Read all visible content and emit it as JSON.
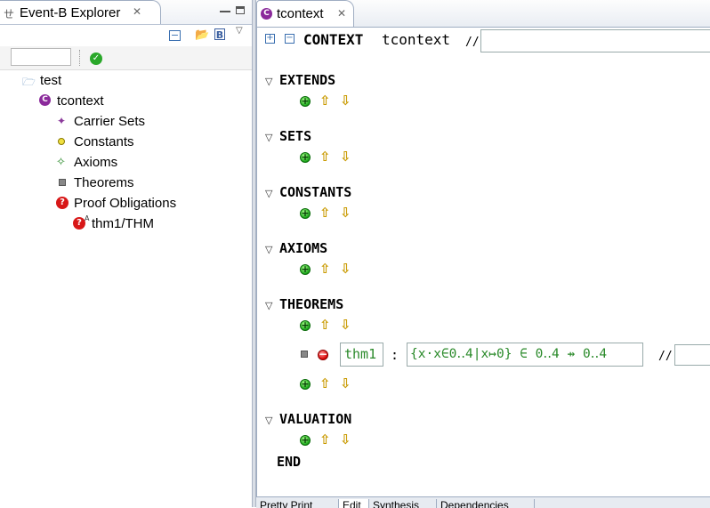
{
  "explorer": {
    "title": "Event-B Explorer",
    "filter_value": "",
    "tree": [
      {
        "label": "test",
        "icon": "folder-open-icon"
      },
      {
        "label": "tcontext",
        "icon": "context-icon"
      },
      {
        "label": "Carrier Sets",
        "icon": "carrier-sets-icon"
      },
      {
        "label": "Constants",
        "icon": "constants-icon"
      },
      {
        "label": "Axioms",
        "icon": "axioms-icon"
      },
      {
        "label": "Theorems",
        "icon": "theorems-icon"
      },
      {
        "label": "Proof Obligations",
        "icon": "proof-obligations-icon"
      },
      {
        "label": "thm1/THM",
        "icon": "proof-obligation-undischarged-icon"
      }
    ]
  },
  "editor": {
    "tab_title": "tcontext",
    "header": {
      "keyword": "CONTEXT",
      "name": "tcontext",
      "comment_mark": "//",
      "comment_value": ""
    },
    "sections": {
      "extends": "EXTENDS",
      "sets": "SETS",
      "constants": "CONSTANTS",
      "axioms": "AXIOMS",
      "theorems": "THEOREMS",
      "valuation": "VALUATION"
    },
    "theorem_row": {
      "label": "thm1",
      "separator": ":",
      "predicate": "{x·x∈0‥4|x↦0} ∈ 0‥4 ⇸ 0‥4",
      "comment_mark": "//",
      "comment_value": ""
    },
    "end_keyword": "END"
  },
  "bottom_tabs": [
    "Pretty Print",
    "Edit",
    "Synthesis",
    "Dependencies"
  ],
  "colors": {
    "accent_green": "#2a8a2a",
    "tab_border": "#9fadc2",
    "add_green": "#1aa51a",
    "delete_red": "#d80000"
  }
}
